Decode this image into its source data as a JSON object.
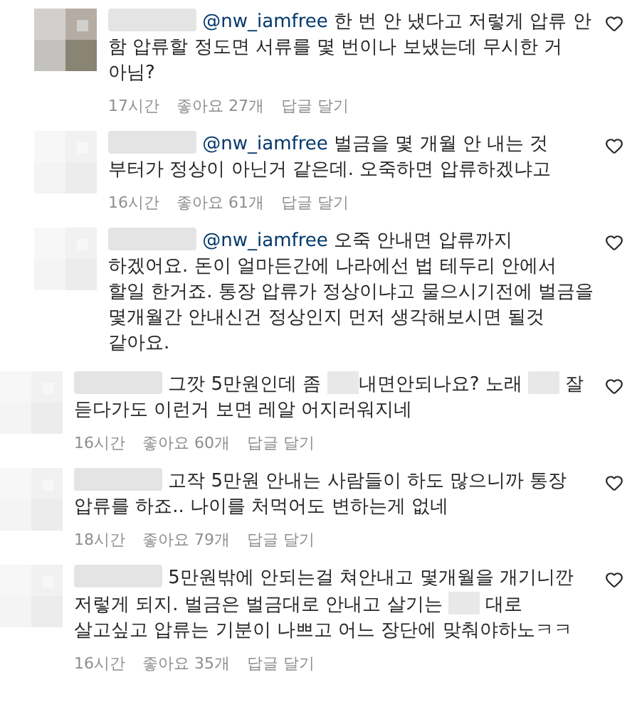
{
  "comments": [
    {
      "kind": "reply",
      "avatar": {
        "kind": "picture"
      },
      "mention": "@nw_iamfree",
      "parts": [
        {
          "kind": "text",
          "text": " 한 번 안 냈다고 저렇게 압류 안 함 압류할 정도면 서류를 몇 번이나 보냈는데 무시한 거 아님?"
        }
      ],
      "time": "17시간",
      "likes": "좋아요 27개",
      "reply_label": "답글 달기"
    },
    {
      "kind": "reply",
      "avatar": {
        "kind": "picture"
      },
      "mention": "@nw_iamfree",
      "parts": [
        {
          "kind": "text",
          "text": " 벌금을 몇 개월 안 내는 것 부터가 정상이 아닌거 같은데. 오죽하면 압류하겠냐고"
        }
      ],
      "time": "16시간",
      "likes": "좋아요 61개",
      "reply_label": "답글 달기"
    },
    {
      "kind": "reply",
      "avatar": {
        "kind": "picture"
      },
      "mention": "@nw_iamfree",
      "parts": [
        {
          "kind": "text",
          "text": " 오죽 안내면 압류까지 하겠어요. 돈이 얼마든간에 나라에선 법 테두리 안에서 할일 한거죠. 통장 압류가 정상이냐고 물으시기전에 벌금을 몇개월간 안내신건 정상인지 먼저 생각해보시면 될것 같아요."
        }
      ]
    },
    {
      "kind": "top",
      "avatar": {
        "kind": "picture"
      },
      "parts": [
        {
          "kind": "text",
          "text": " 그깟 5만원인데 좀 "
        },
        {
          "kind": "redacted"
        },
        {
          "kind": "text",
          "text": "내면안되나요? 노래 "
        },
        {
          "kind": "redacted"
        },
        {
          "kind": "text",
          "text": " 잘 듣다가도 이런거 보면 레알 어지러워지네"
        }
      ],
      "time": "16시간",
      "likes": "좋아요 60개",
      "reply_label": "답글 달기"
    },
    {
      "kind": "top",
      "avatar": {
        "kind": "picture"
      },
      "parts": [
        {
          "kind": "text",
          "text": " 고작 5만원 안내는 사람들이 하도 많으니까 통장 압류를 하죠.. 나이를 처먹어도 변하는게 없네"
        }
      ],
      "time": "18시간",
      "likes": "좋아요 79개",
      "reply_label": "답글 달기"
    },
    {
      "kind": "top",
      "avatar": {
        "kind": "picture"
      },
      "parts": [
        {
          "kind": "text",
          "text": " 5만원밖에 안되는걸 쳐안내고 몇개월을 개기니깐 저렇게 되지. 벌금은 벌금대로 안내고 살기는 "
        },
        {
          "kind": "redacted"
        },
        {
          "kind": "text",
          "text": " 대로 살고싶고 압류는 기분이 나쁘고 어느 장단에 맞춰야하노ㅋㅋ"
        }
      ],
      "time": "16시간",
      "likes": "좋아요 35개",
      "reply_label": "답글 달기"
    }
  ]
}
